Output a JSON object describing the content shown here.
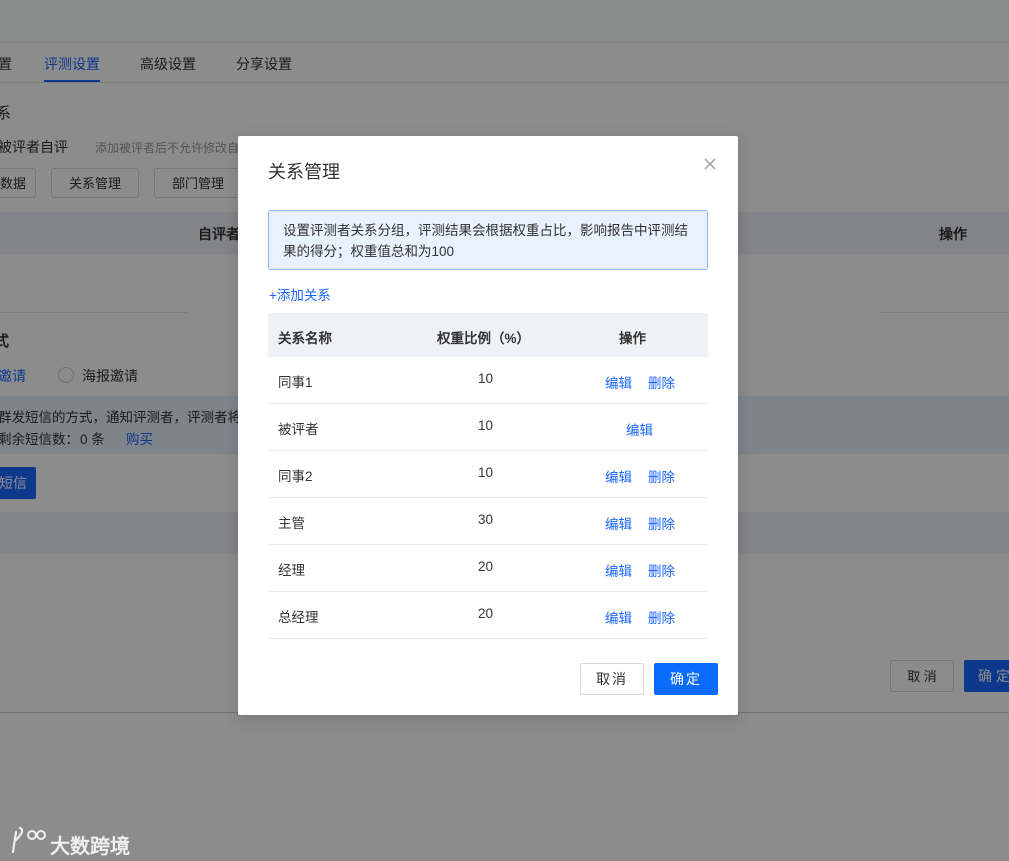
{
  "background": {
    "tabs": [
      "置",
      "评测设置",
      "高级设置",
      "分享设置"
    ],
    "section_title_1": "系",
    "self_eval_label": "被评者自评",
    "self_eval_hint": "添加被评者后不允许修改自",
    "buttons": [
      "数据",
      "关系管理",
      "部门管理"
    ],
    "table_headers": [
      "自评者",
      "操作"
    ],
    "section_title_2": "式",
    "invite_options": [
      "邀请",
      "海报邀请"
    ],
    "notice_line1": "群发短信的方式，通知评测者，评测者将",
    "notice_line2_label": "剩余短信数：",
    "notice_line2_value": "0 条",
    "buy_link": "购买",
    "send_sms_button": "短信",
    "footer_cancel": "取 消",
    "footer_ok": "确 定"
  },
  "modal": {
    "title": "关系管理",
    "alert_text": "设置评测者关系分组，评测结果会根据权重占比，影响报告中评测结果的得分；权重值总和为100",
    "add_relation_link": "+添加关系",
    "table": {
      "headers": [
        "关系名称",
        "权重比例（%）",
        "操作"
      ],
      "rows": [
        {
          "name": "同事1",
          "weight": "10",
          "actions": [
            "编辑",
            "删除"
          ]
        },
        {
          "name": "被评者",
          "weight": "10",
          "actions": [
            "编辑"
          ]
        },
        {
          "name": "同事2",
          "weight": "10",
          "actions": [
            "编辑",
            "删除"
          ]
        },
        {
          "name": "主管",
          "weight": "30",
          "actions": [
            "编辑",
            "删除"
          ]
        },
        {
          "name": "经理",
          "weight": "20",
          "actions": [
            "编辑",
            "删除"
          ]
        },
        {
          "name": "总经理",
          "weight": "20",
          "actions": [
            "编辑",
            "删除"
          ]
        }
      ]
    },
    "cancel_button": "取消",
    "ok_button": "确定"
  },
  "watermark": {
    "text": "大数跨境"
  },
  "colors": {
    "accent": "#1a66ff",
    "primary_button": "#0a6cff",
    "alert_bg": "#e8f1fe",
    "overlay": "rgba(0,0,0,0.45)"
  }
}
